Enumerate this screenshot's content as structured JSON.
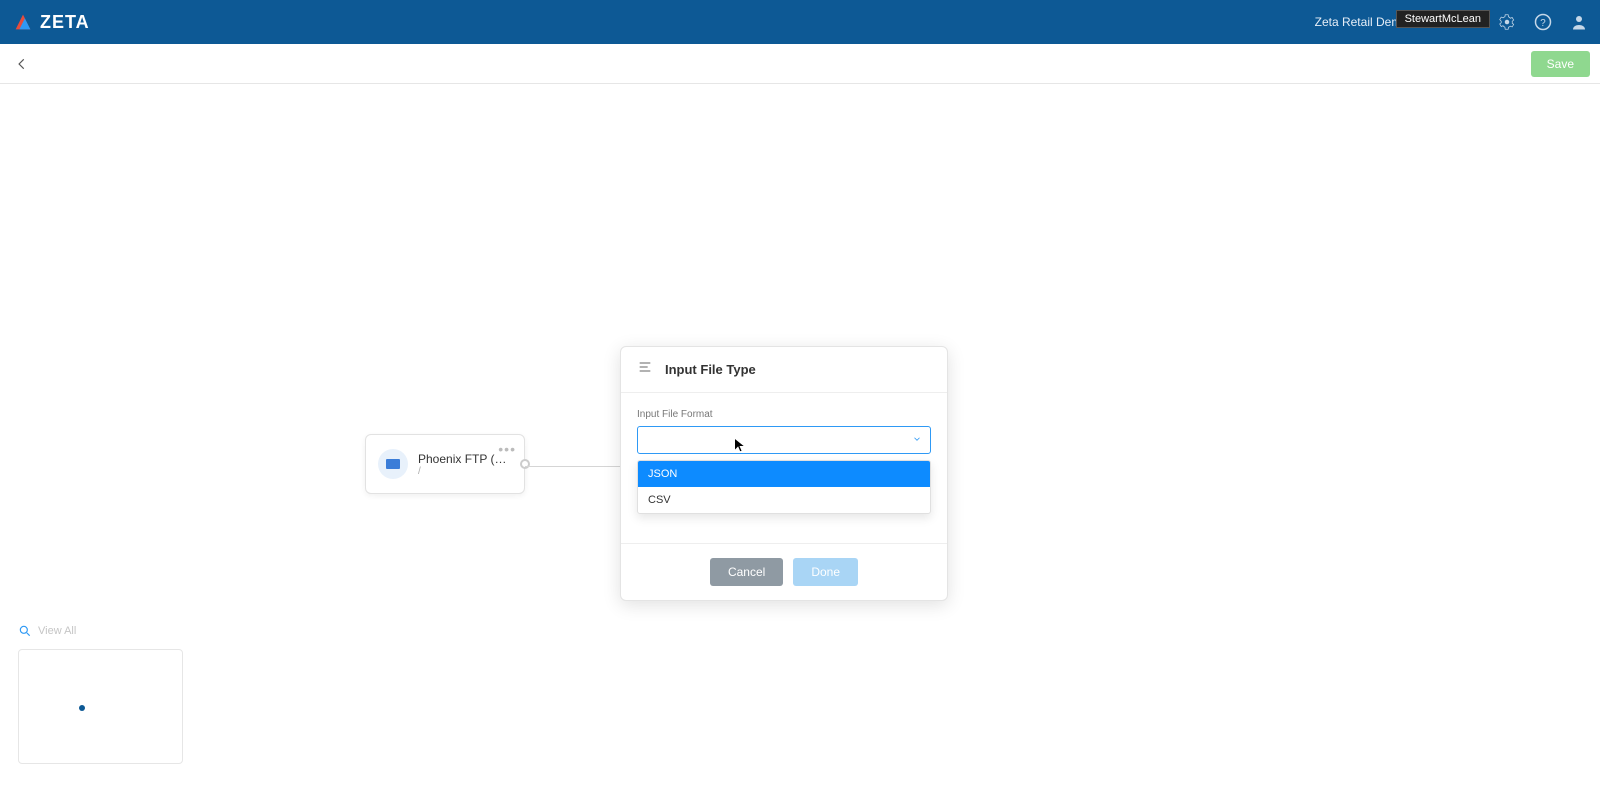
{
  "header": {
    "brand": "ZETA",
    "org": "Zeta Retail Demo",
    "user_tag": "StewartMcLean"
  },
  "toolbar": {
    "save_label": "Save"
  },
  "node": {
    "title": "Phoenix FTP (BM...",
    "subtitle": "/"
  },
  "modal": {
    "title": "Input File Type",
    "field_label": "Input File Format",
    "options": {
      "json": "JSON",
      "csv": "CSV"
    },
    "cancel_label": "Cancel",
    "done_label": "Done"
  },
  "minimap": {
    "search_placeholder": "View All"
  }
}
